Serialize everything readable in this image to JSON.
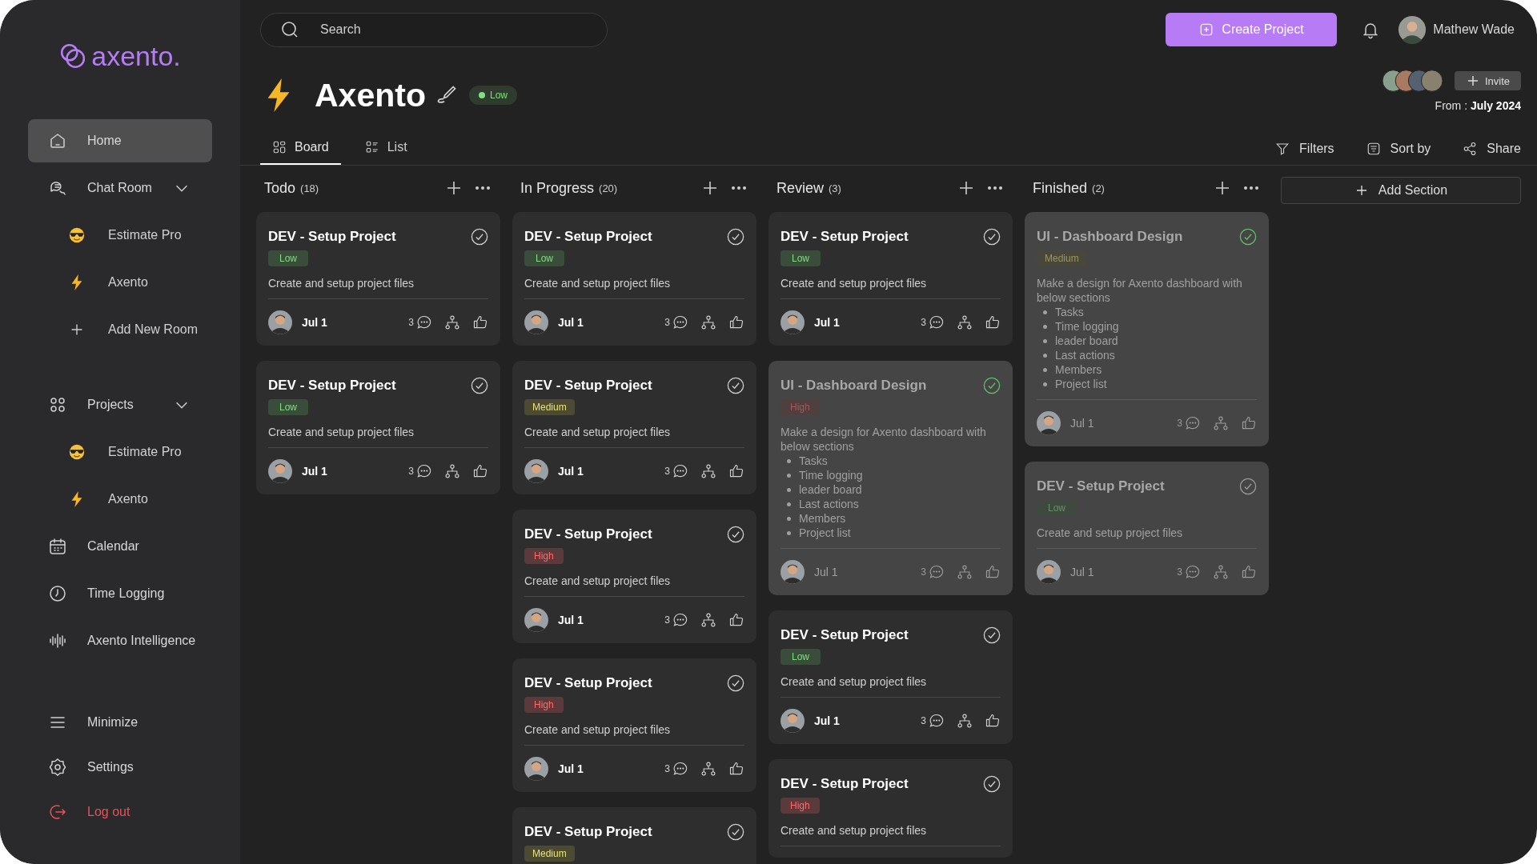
{
  "sidebar": {
    "logo": "axento.",
    "items": [
      {
        "label": "Home",
        "selected": true
      },
      {
        "label": "Chat Room",
        "selected": false,
        "expanded": true,
        "children": [
          {
            "label": "Estimate Pro"
          },
          {
            "label": "Axento"
          },
          {
            "label": "Add New Room"
          }
        ]
      },
      {
        "label": "Projects",
        "selected": false,
        "expanded": true,
        "children": [
          {
            "label": "Estimate Pro"
          },
          {
            "label": "Axento"
          }
        ]
      },
      {
        "label": "Calendar",
        "selected": false
      },
      {
        "label": "Time Logging",
        "selected": false
      },
      {
        "label": "Axento Intelligence",
        "selected": false
      }
    ],
    "bottom": [
      {
        "label": "Minimize",
        "kind": "normal"
      },
      {
        "label": "Settings",
        "kind": "normal"
      },
      {
        "label": "Log out",
        "kind": "danger"
      }
    ]
  },
  "search": {
    "placeholder": "Search"
  },
  "create_button": "Create Project",
  "user": {
    "name": "Mathew Wade"
  },
  "project": {
    "title": "Axento",
    "priority": "Low",
    "invite": "Invite",
    "from": "From : **July 2024**"
  },
  "tabs": [
    {
      "label": "Board",
      "selected": true
    },
    {
      "label": "List",
      "selected": false
    }
  ],
  "toolbar": [
    "Filters",
    "Sort by",
    "Share"
  ],
  "columns": [
    {
      "name": "Todo",
      "count": "(18)",
      "cards": [
        {
          "title": "DEV - Setup Project",
          "priority": "Low",
          "description": "Create and setup project files",
          "date": "Jul 1",
          "comments": "3",
          "faded": false,
          "done": false
        },
        {
          "title": "DEV - Setup Project",
          "priority": "Low",
          "description": "Create and setup project files",
          "date": "Jul 1",
          "comments": "3",
          "faded": false,
          "done": false
        }
      ]
    },
    {
      "name": "In Progress",
      "count": "(20)",
      "cards": [
        {
          "title": "DEV - Setup Project",
          "priority": "Low",
          "description": "Create and setup project files",
          "date": "Jul 1",
          "comments": "3",
          "faded": false,
          "done": false
        },
        {
          "title": "DEV - Setup Project",
          "priority": "Medium",
          "description": "Create and setup project files",
          "date": "Jul 1",
          "comments": "3",
          "faded": false,
          "done": false
        },
        {
          "title": "DEV - Setup Project",
          "priority": "High",
          "description": "Create and setup project files",
          "date": "Jul 1",
          "comments": "3",
          "faded": false,
          "done": false
        },
        {
          "title": "DEV - Setup Project",
          "priority": "High",
          "description": "Create and setup project files",
          "date": "Jul 1",
          "comments": "3",
          "faded": false,
          "done": false
        },
        {
          "title": "DEV - Setup Project",
          "priority": "Medium",
          "faded": false,
          "done": false
        }
      ]
    },
    {
      "name": "Review",
      "count": "(3)",
      "cards": [
        {
          "title": "DEV - Setup Project",
          "priority": "Low",
          "description": "Create and setup project files",
          "date": "Jul 1",
          "comments": "3",
          "faded": false,
          "done": false
        },
        {
          "title": "UI - Dashboard Design",
          "priority": "High",
          "description": "Make a design for Axento dashboard with below sections",
          "bullets": [
            "Tasks",
            "Time logging",
            "leader board",
            "Last actions",
            "Members",
            "Project list"
          ],
          "date": "Jul 1",
          "comments": "3",
          "faded": true,
          "done": true
        },
        {
          "title": "DEV - Setup Project",
          "priority": "Low",
          "description": "Create and setup project files",
          "date": "Jul 1",
          "comments": "3",
          "faded": false,
          "done": false
        },
        {
          "title": "DEV - Setup Project",
          "priority": "High",
          "description": "Create and setup project files",
          "faded": false,
          "done": false
        }
      ]
    },
    {
      "name": "Finished",
      "count": "(2)",
      "cards": [
        {
          "title": "UI - Dashboard Design",
          "priority": "Medium",
          "description": "Make a design for Axento dashboard with below sections",
          "bullets": [
            "Tasks",
            "Time logging",
            "leader board",
            "Last actions",
            "Members",
            "Project list"
          ],
          "date": "Jul 1",
          "comments": "3",
          "faded": true,
          "done": true
        },
        {
          "title": "DEV - Setup Project",
          "priority": "Low",
          "description": "Create and setup project files",
          "date": "Jul 1",
          "comments": "3",
          "faded": true,
          "done": false
        }
      ]
    }
  ],
  "add_section": "Add Section"
}
